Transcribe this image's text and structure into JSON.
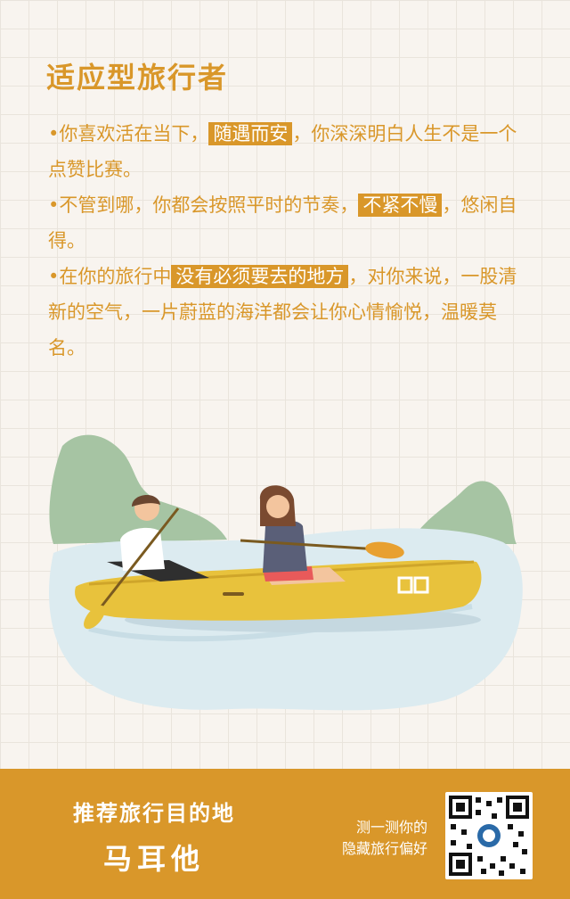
{
  "heading": "适应型旅行者",
  "paragraphs": [
    {
      "before": "•你喜欢活在当下，",
      "highlight": "随遇而安",
      "after": "，你深深明白人生不是一个点赞比赛。"
    },
    {
      "before": "•不管到哪，你都会按照平时的节奏，",
      "highlight": "不紧不慢",
      "after": "，悠闲自得。"
    },
    {
      "before": "•在你的旅行中",
      "highlight": "没有必须要去的地方",
      "after": "，对你来说，一股清新的空气，一片蔚蓝的海洋都会让你心情愉悦，温暖莫名。"
    }
  ],
  "footer": {
    "label": "推荐旅行目的地",
    "destination": "马耳他",
    "cta_line1": "测一测你的",
    "cta_line2": "隐藏旅行偏好"
  },
  "colors": {
    "accent": "#d9972a",
    "background": "#f8f4ef",
    "water": "#dcebf0",
    "boat": "#e8c23c"
  },
  "icons": {
    "boat_logo": "ef-logo",
    "qr": "qr-code"
  }
}
